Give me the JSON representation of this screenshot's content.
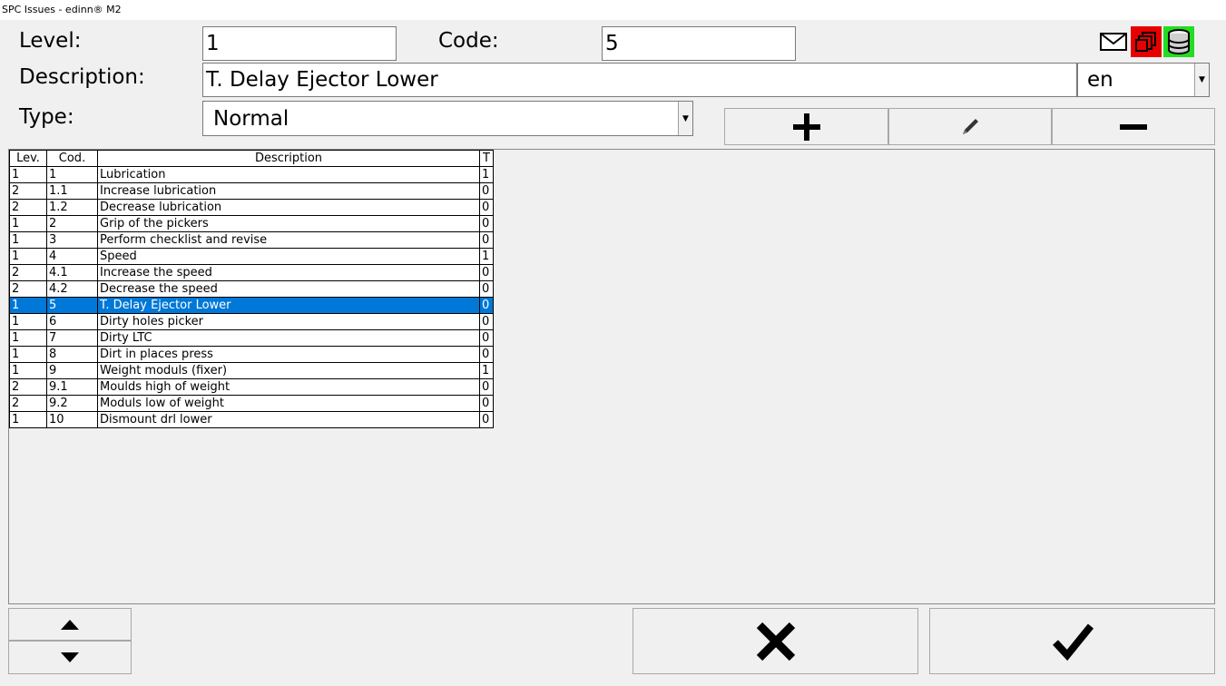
{
  "window": {
    "title": "SPC Issues - edinn® M2"
  },
  "form": {
    "level_label": "Level:",
    "level_value": "1",
    "code_label": "Code:",
    "code_value": "5",
    "description_label": "Description:",
    "description_value": "T. Delay Ejector Lower",
    "language_value": "en",
    "type_label": "Type:",
    "type_value": "Normal"
  },
  "toolbar": {
    "icons": [
      "mail-icon",
      "windows-icon",
      "database-icon"
    ],
    "colors": {
      "windows_bg": "#e60000",
      "database_bg": "#22dd22"
    }
  },
  "table": {
    "headers": [
      "Lev.",
      "Cod.",
      "Description",
      "T"
    ],
    "selected_index": 8,
    "selection_color": "#0078d7",
    "rows": [
      [
        "1",
        "1",
        "Lubrication",
        "1"
      ],
      [
        "2",
        "1.1",
        "Increase lubrication",
        "0"
      ],
      [
        "2",
        "1.2",
        "Decrease lubrication",
        "0"
      ],
      [
        "1",
        "2",
        "Grip of the pickers",
        "0"
      ],
      [
        "1",
        "3",
        "Perform checklist and revise",
        "0"
      ],
      [
        "1",
        "4",
        "Speed",
        "1"
      ],
      [
        "2",
        "4.1",
        "Increase the speed",
        "0"
      ],
      [
        "2",
        "4.2",
        "Decrease the speed",
        "0"
      ],
      [
        "1",
        "5",
        "T. Delay Ejector Lower",
        "0"
      ],
      [
        "1",
        "6",
        "Dirty holes picker",
        "0"
      ],
      [
        "1",
        "7",
        "Dirty LTC",
        "0"
      ],
      [
        "1",
        "8",
        "Dirt in places press",
        "0"
      ],
      [
        "1",
        "9",
        "Weight moduls (fixer)",
        "1"
      ],
      [
        "2",
        "9.1",
        "Moulds high of weight",
        "0"
      ],
      [
        "2",
        "9.2",
        "Moduls low of weight",
        "0"
      ],
      [
        "1",
        "10",
        "Dismount drl lower",
        "0"
      ]
    ]
  },
  "actions": {
    "add": "plus-icon",
    "edit": "pencil-icon",
    "remove": "minus-icon",
    "move_up": "triangle-up-icon",
    "move_down": "triangle-down-icon",
    "cancel": "x-icon",
    "confirm": "check-icon"
  }
}
